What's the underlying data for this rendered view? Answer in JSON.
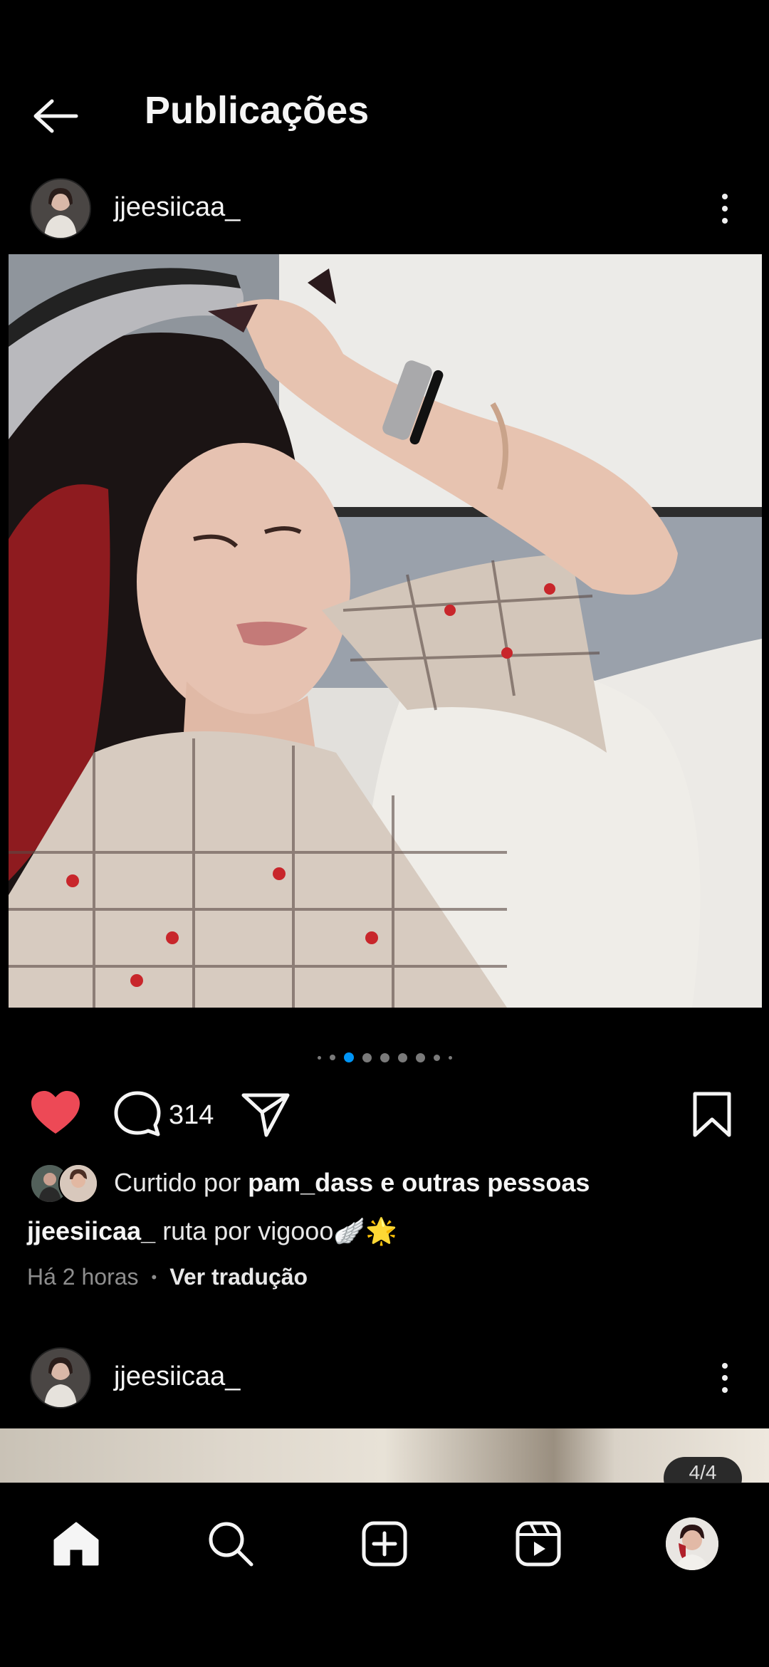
{
  "header": {
    "title": "Publicações",
    "back_icon": "arrow-left-icon"
  },
  "post1": {
    "username": "jjeesiicaa_",
    "image_alt": "Selfie photo",
    "carousel": {
      "total": 8,
      "active_index": 2
    },
    "actions": {
      "liked": true,
      "like_color": "#ed4956",
      "comment_count": "314"
    },
    "likes": {
      "prefix": "Curtido por",
      "user": "pam_dass",
      "suffix": "e outras pessoas"
    },
    "caption": {
      "username": "jjeesiicaa_",
      "text": "ruta por vigooo🪽🌟"
    },
    "time": "Há 2 horas",
    "separator": "•",
    "translate": "Ver tradução"
  },
  "post2": {
    "username": "jjeesiicaa_",
    "counter": "4/4"
  },
  "nav": {
    "items": [
      "home-icon",
      "search-icon",
      "create-icon",
      "reels-icon",
      "profile-avatar"
    ]
  },
  "colors": {
    "active_dot": "#0095f6",
    "background": "#000000"
  }
}
